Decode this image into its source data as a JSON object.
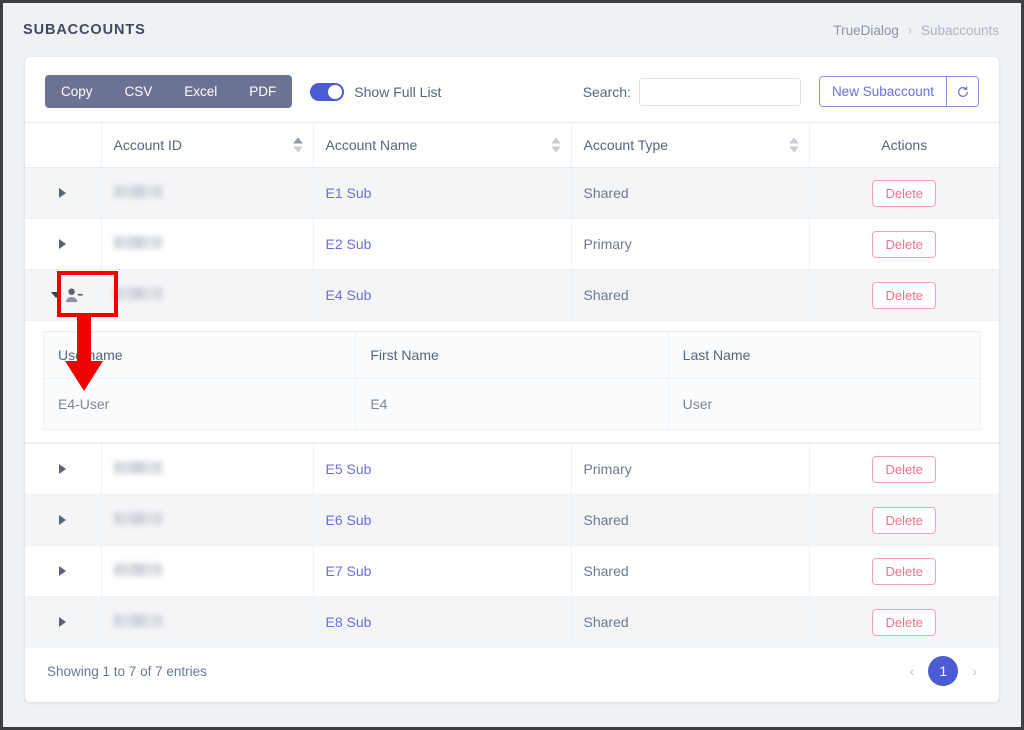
{
  "header": {
    "title": "SUBACCOUNTS",
    "breadcrumb": {
      "root": "TrueDialog",
      "separator": "›",
      "current": "Subaccounts"
    }
  },
  "toolbar": {
    "export_buttons": [
      "Copy",
      "CSV",
      "Excel",
      "PDF"
    ],
    "toggle": {
      "label": "Show Full List",
      "state": "on"
    },
    "search": {
      "label": "Search:",
      "value": "",
      "placeholder": ""
    },
    "new_subaccount_label": "New Subaccount",
    "refresh_icon": "refresh-icon"
  },
  "table": {
    "columns": [
      "",
      "Account ID",
      "Account Name",
      "Account Type",
      "Actions"
    ],
    "delete_label": "Delete",
    "rows": [
      {
        "id_redacted": true,
        "name": "E1 Sub",
        "type": "Shared",
        "expanded": false,
        "stripe": "alt"
      },
      {
        "id_redacted": true,
        "name": "E2 Sub",
        "type": "Primary",
        "expanded": false,
        "stripe": "plain"
      },
      {
        "id_redacted": true,
        "name": "E4 Sub",
        "type": "Shared",
        "expanded": true,
        "stripe": "alt"
      },
      {
        "id_redacted": true,
        "name": "E5 Sub",
        "type": "Primary",
        "expanded": false,
        "stripe": "plain"
      },
      {
        "id_redacted": true,
        "name": "E6 Sub",
        "type": "Shared",
        "expanded": false,
        "stripe": "alt"
      },
      {
        "id_redacted": true,
        "name": "E7 Sub",
        "type": "Shared",
        "expanded": false,
        "stripe": "plain"
      },
      {
        "id_redacted": true,
        "name": "E8 Sub",
        "type": "Shared",
        "expanded": false,
        "stripe": "alt"
      }
    ]
  },
  "nested_table": {
    "columns": [
      "Username",
      "First Name",
      "Last Name"
    ],
    "rows": [
      {
        "username": "E4-User",
        "first_name": "E4",
        "last_name": "User"
      }
    ]
  },
  "footer": {
    "entries_info": "Showing 1 to 7 of 7 entries",
    "prev_label": "‹",
    "next_label": "›",
    "current_page": "1"
  },
  "annotation": {
    "color": "#f00000",
    "highlight_target": "expand-user-icon",
    "arrow_points_to": "E4-User"
  },
  "colors": {
    "page_background": "#eef2f5",
    "accent_blue": "#4c5bd4",
    "link_purple": "#6b6fdc",
    "delete_pink": "#f4708c",
    "export_bar": "#6c7293",
    "annotation_red": "#f00000"
  }
}
